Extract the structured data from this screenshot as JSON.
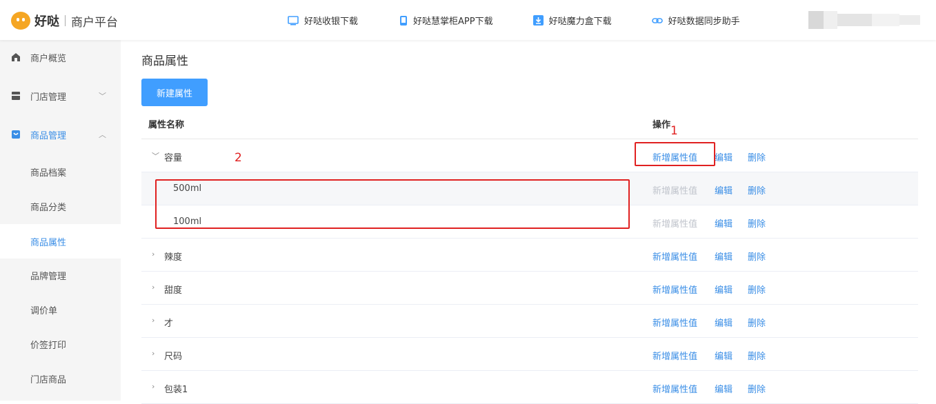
{
  "header": {
    "brand": "好哒",
    "subtitle": "商户平台",
    "links": [
      {
        "label": "好哒收银下载",
        "icon": "monitor-icon"
      },
      {
        "label": "好哒慧掌柜APP下载",
        "icon": "phone-icon"
      },
      {
        "label": "好哒魔力盒下载",
        "icon": "download-icon"
      },
      {
        "label": "好哒数据同步助手",
        "icon": "link-icon"
      }
    ]
  },
  "sidebar": {
    "items": [
      {
        "label": "商户概览",
        "icon": "home-icon"
      },
      {
        "label": "门店管理",
        "icon": "store-icon",
        "chevron": "﹀"
      },
      {
        "label": "商品管理",
        "icon": "bag-icon",
        "chevron": "︿"
      },
      {
        "label": "商品档案"
      },
      {
        "label": "商品分类"
      },
      {
        "label": "商品属性"
      },
      {
        "label": "品牌管理"
      },
      {
        "label": "调价单"
      },
      {
        "label": "价签打印"
      },
      {
        "label": "门店商品"
      }
    ]
  },
  "main": {
    "title": "商品属性",
    "new_button": "新建属性",
    "table": {
      "col_name": "属性名称",
      "col_ops": "操作",
      "actions": {
        "add": "新增属性值",
        "edit": "编辑",
        "delete": "删除"
      },
      "rows": [
        {
          "name": "容量",
          "arrow": "﹀"
        },
        {
          "name": "500ml"
        },
        {
          "name": "100ml"
        },
        {
          "name": "辣度",
          "arrow": "›"
        },
        {
          "name": "甜度",
          "arrow": "›"
        },
        {
          "name": "才",
          "arrow": "›"
        },
        {
          "name": "尺码",
          "arrow": "›"
        },
        {
          "name": "包装1",
          "arrow": "›"
        }
      ]
    }
  },
  "annotations": {
    "one": "1",
    "two": "2"
  },
  "colors": {
    "accent": "#409eff",
    "link": "#3a8ee6",
    "annotation": "#e02020",
    "logo": "#f5a623"
  }
}
